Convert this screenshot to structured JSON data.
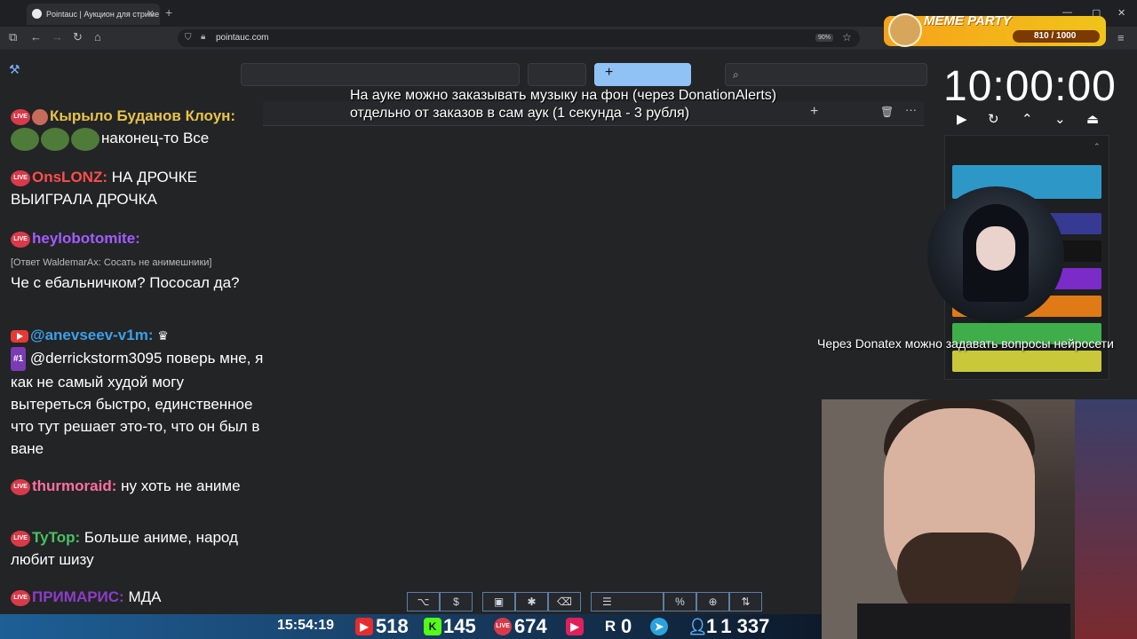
{
  "browser": {
    "tab_title": "Pointauc | Аукцион для стриме",
    "url": "pointauc.com",
    "zoom": "90%",
    "new_tab": "+",
    "window_controls": [
      "—",
      "▢",
      "✕"
    ]
  },
  "meme_party": {
    "title": "MEME PARTY",
    "progress": "810 / 1000"
  },
  "auction": {
    "add_label": "+",
    "search_icon": "search-icon",
    "lot_actions": {
      "add": "+",
      "delete": "🗑",
      "more": "···"
    }
  },
  "overlay_text": "На ауке можно заказывать музыку на фон (через DonationAlerts) отдельно от заказов в сам аук (1 секунда - 3 рубля)",
  "timer": {
    "value": "10:00:00",
    "controls": [
      "▶",
      "↻",
      "⌃",
      "⌄",
      "⏏"
    ]
  },
  "slots": {
    "colors": [
      "#2d98c8",
      "#373a92",
      "#141414",
      "#7a2bc8",
      "#e07a16",
      "#3fae4a",
      "#c8c83a"
    ]
  },
  "donatex_text": "Через Donatex можно задавать вопросы нейросети",
  "chat": [
    {
      "platform": "live",
      "nick": "Кырыло Буданов Клоун:",
      "nick_color": "#e7c34a",
      "text": "наконец-то Все"
    },
    {
      "platform": "live",
      "nick": "OnsLONZ:",
      "nick_color": "#ff4d4d",
      "text": "НА ДРОЧКЕ ВЫИГРАЛА ДРОЧКА"
    },
    {
      "platform": "live",
      "nick": "heylobotomite:",
      "nick_color": "#a35cff",
      "reply": "[Ответ WaldemarAx: Сосать не анимешники]",
      "text": "Че с ебальничком? Пососал да?"
    },
    {
      "platform": "youtube",
      "nick": "@anevseev-v1m:",
      "nick_color": "#3aa0e8",
      "rank": "#1",
      "text": "@derrickstorm3095 поверь мне, я как не самый худой могу вытереться быстро, единственное что тут решает это-то, что он был в ване"
    },
    {
      "platform": "live",
      "nick": "thurmoraid:",
      "nick_color": "#ff6fa0",
      "text": "ну хоть не аниме"
    },
    {
      "platform": "live",
      "nick": "TyTop:",
      "nick_color": "#48c262",
      "text": "Больше аниме, народ любит шизу"
    },
    {
      "platform": "live",
      "nick": "ПРИМАРИС:",
      "nick_color": "#8d3cc9",
      "text": "МДА"
    }
  ],
  "toolbar": {
    "buttons": [
      "github-icon",
      "$",
      "save-icon",
      "bug-icon",
      "clear-icon",
      "list-icon",
      "%",
      "⊕",
      "⇅"
    ]
  },
  "stats": {
    "clock": "15:54:19",
    "youtube": "518",
    "kick": "145",
    "live": "674",
    "rutube": "0",
    "telegram": "1",
    "viewers": "1 337",
    "live_label": "LIVE",
    "r_label": "R"
  }
}
